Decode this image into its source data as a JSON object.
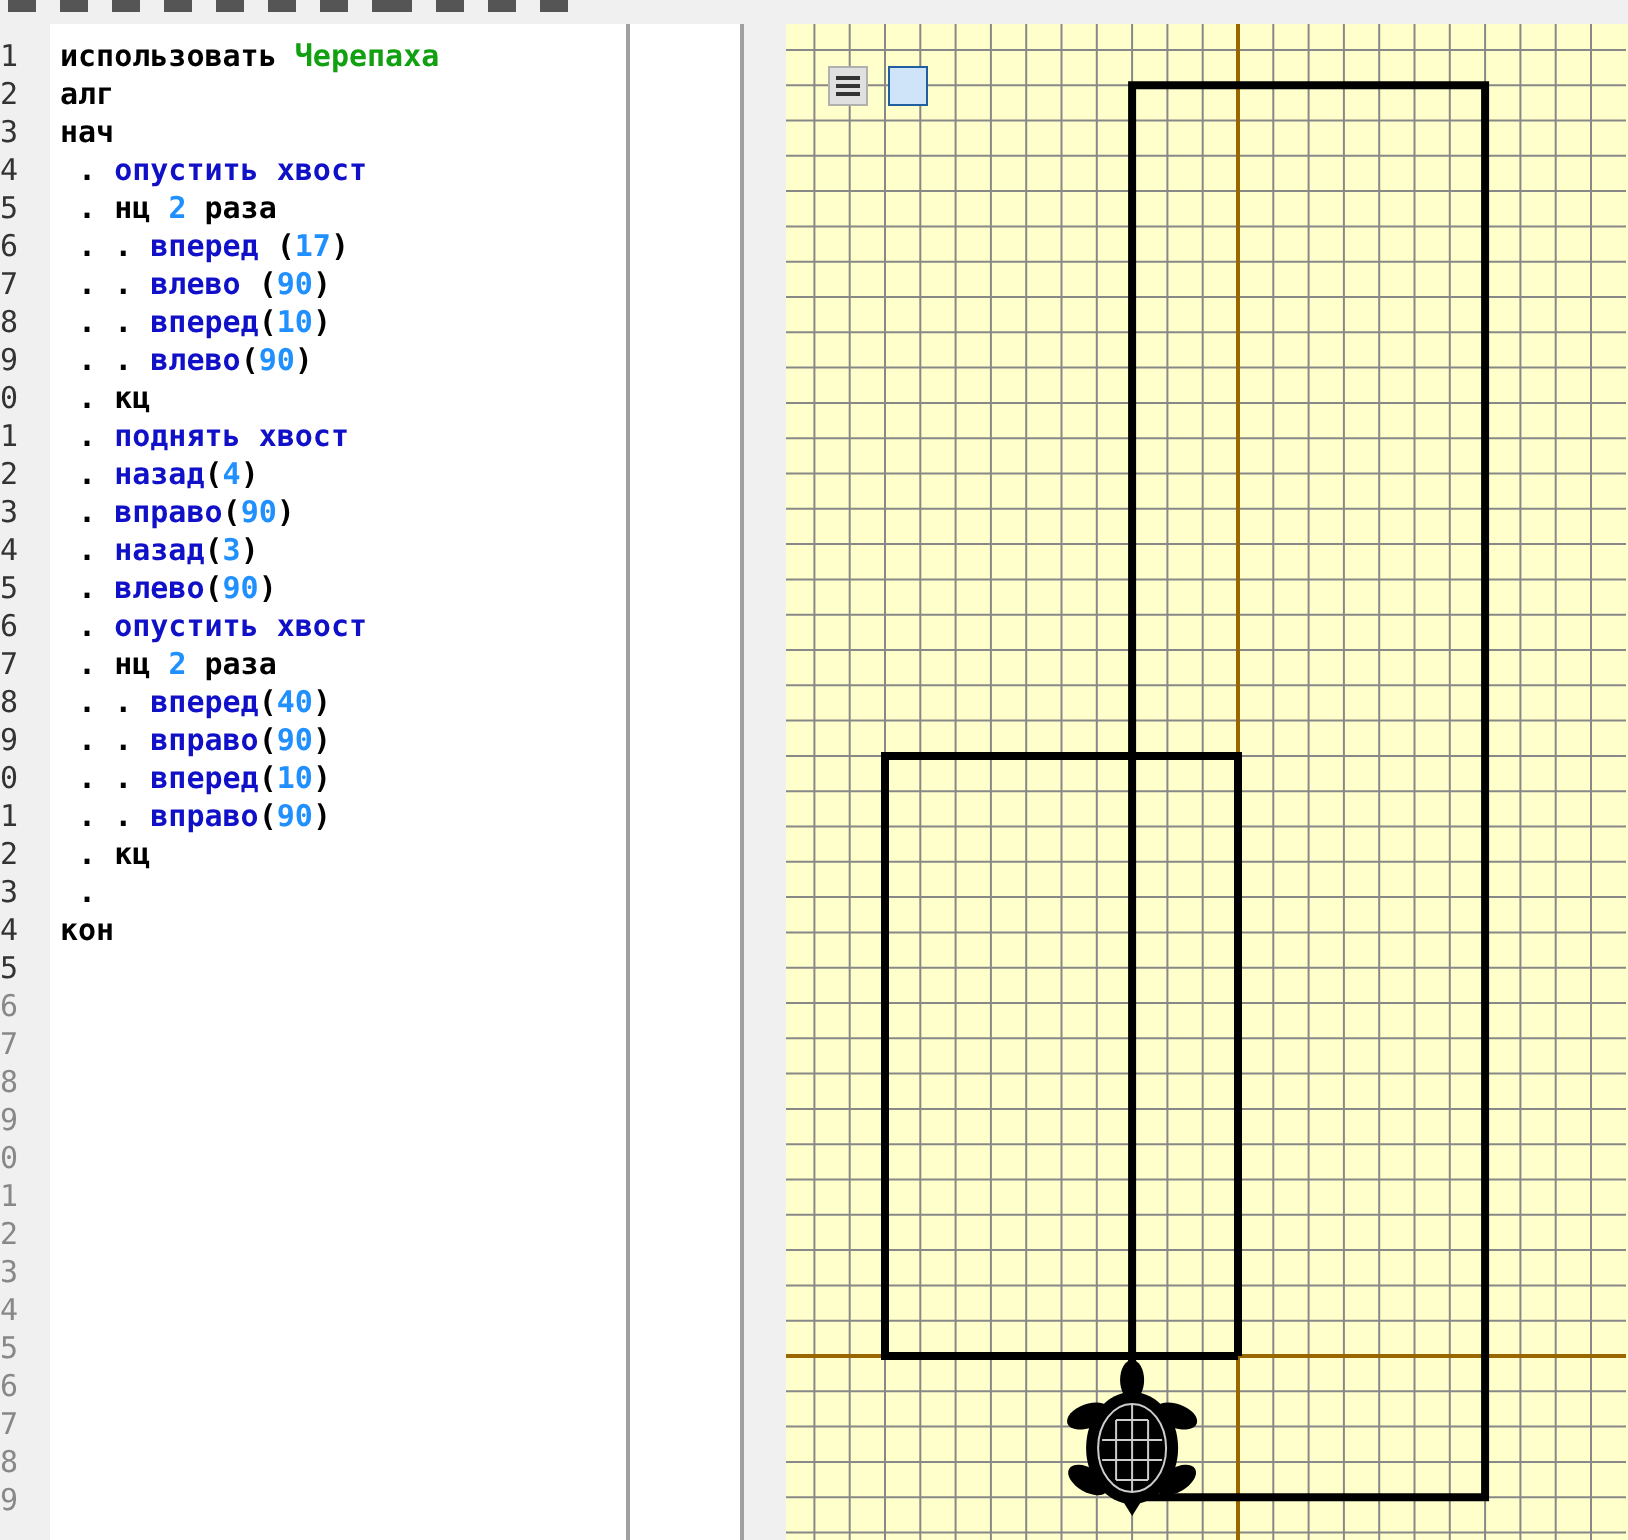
{
  "editor": {
    "lines": [
      {
        "number": "1",
        "tokens": [
          {
            "kind": "keyword",
            "text": "использовать "
          },
          {
            "kind": "module",
            "text": "Черепаха"
          }
        ]
      },
      {
        "number": "2",
        "tokens": [
          {
            "kind": "keyword",
            "text": "алг"
          }
        ]
      },
      {
        "number": "3",
        "tokens": [
          {
            "kind": "keyword",
            "text": "нач"
          }
        ]
      },
      {
        "number": "4",
        "tokens": [
          {
            "kind": "dot",
            "text": " . "
          },
          {
            "kind": "command",
            "text": "опустить хвост"
          }
        ]
      },
      {
        "number": "5",
        "tokens": [
          {
            "kind": "dot",
            "text": " . "
          },
          {
            "kind": "keyword",
            "text": "нц "
          },
          {
            "kind": "number",
            "text": "2"
          },
          {
            "kind": "keyword",
            "text": " раза"
          }
        ]
      },
      {
        "number": "6",
        "tokens": [
          {
            "kind": "dot",
            "text": " . . "
          },
          {
            "kind": "command",
            "text": "вперед "
          },
          {
            "kind": "paren",
            "text": "("
          },
          {
            "kind": "number",
            "text": "17"
          },
          {
            "kind": "paren",
            "text": ")"
          }
        ]
      },
      {
        "number": "7",
        "tokens": [
          {
            "kind": "dot",
            "text": " . . "
          },
          {
            "kind": "command",
            "text": "влево "
          },
          {
            "kind": "paren",
            "text": "("
          },
          {
            "kind": "number",
            "text": "90"
          },
          {
            "kind": "paren",
            "text": ")"
          }
        ]
      },
      {
        "number": "8",
        "tokens": [
          {
            "kind": "dot",
            "text": " . . "
          },
          {
            "kind": "command",
            "text": "вперед"
          },
          {
            "kind": "paren",
            "text": "("
          },
          {
            "kind": "number",
            "text": "10"
          },
          {
            "kind": "paren",
            "text": ")"
          }
        ]
      },
      {
        "number": "9",
        "tokens": [
          {
            "kind": "dot",
            "text": " . . "
          },
          {
            "kind": "command",
            "text": "влево"
          },
          {
            "kind": "paren",
            "text": "("
          },
          {
            "kind": "number",
            "text": "90"
          },
          {
            "kind": "paren",
            "text": ")"
          }
        ]
      },
      {
        "number": "0",
        "tokens": [
          {
            "kind": "dot",
            "text": " . "
          },
          {
            "kind": "keyword",
            "text": "кц"
          }
        ]
      },
      {
        "number": "1",
        "tokens": [
          {
            "kind": "dot",
            "text": " . "
          },
          {
            "kind": "command",
            "text": "поднять хвост"
          }
        ]
      },
      {
        "number": "2",
        "tokens": [
          {
            "kind": "dot",
            "text": " . "
          },
          {
            "kind": "command",
            "text": "назад"
          },
          {
            "kind": "paren",
            "text": "("
          },
          {
            "kind": "number",
            "text": "4"
          },
          {
            "kind": "paren",
            "text": ")"
          }
        ]
      },
      {
        "number": "3",
        "tokens": [
          {
            "kind": "dot",
            "text": " . "
          },
          {
            "kind": "command",
            "text": "вправо"
          },
          {
            "kind": "paren",
            "text": "("
          },
          {
            "kind": "number",
            "text": "90"
          },
          {
            "kind": "paren",
            "text": ")"
          }
        ]
      },
      {
        "number": "4",
        "tokens": [
          {
            "kind": "dot",
            "text": " . "
          },
          {
            "kind": "command",
            "text": "назад"
          },
          {
            "kind": "paren",
            "text": "("
          },
          {
            "kind": "number",
            "text": "3"
          },
          {
            "kind": "paren",
            "text": ")"
          }
        ]
      },
      {
        "number": "5",
        "tokens": [
          {
            "kind": "dot",
            "text": " . "
          },
          {
            "kind": "command",
            "text": "влево"
          },
          {
            "kind": "paren",
            "text": "("
          },
          {
            "kind": "number",
            "text": "90"
          },
          {
            "kind": "paren",
            "text": ")"
          }
        ]
      },
      {
        "number": "6",
        "tokens": [
          {
            "kind": "dot",
            "text": " . "
          },
          {
            "kind": "command",
            "text": "опустить хвост"
          }
        ]
      },
      {
        "number": "7",
        "tokens": [
          {
            "kind": "dot",
            "text": " . "
          },
          {
            "kind": "keyword",
            "text": "нц "
          },
          {
            "kind": "number",
            "text": "2"
          },
          {
            "kind": "keyword",
            "text": " раза"
          }
        ]
      },
      {
        "number": "8",
        "tokens": [
          {
            "kind": "dot",
            "text": " . . "
          },
          {
            "kind": "command",
            "text": "вперед"
          },
          {
            "kind": "paren",
            "text": "("
          },
          {
            "kind": "number",
            "text": "40"
          },
          {
            "kind": "paren",
            "text": ")"
          }
        ]
      },
      {
        "number": "9",
        "tokens": [
          {
            "kind": "dot",
            "text": " . . "
          },
          {
            "kind": "command",
            "text": "вправо"
          },
          {
            "kind": "paren",
            "text": "("
          },
          {
            "kind": "number",
            "text": "90"
          },
          {
            "kind": "paren",
            "text": ")"
          }
        ]
      },
      {
        "number": "0",
        "tokens": [
          {
            "kind": "dot",
            "text": " . . "
          },
          {
            "kind": "command",
            "text": "вперед"
          },
          {
            "kind": "paren",
            "text": "("
          },
          {
            "kind": "number",
            "text": "10"
          },
          {
            "kind": "paren",
            "text": ")"
          }
        ]
      },
      {
        "number": "1",
        "tokens": [
          {
            "kind": "dot",
            "text": " . . "
          },
          {
            "kind": "command",
            "text": "вправо"
          },
          {
            "kind": "paren",
            "text": "("
          },
          {
            "kind": "number",
            "text": "90"
          },
          {
            "kind": "paren",
            "text": ")"
          }
        ]
      },
      {
        "number": "2",
        "tokens": [
          {
            "kind": "dot",
            "text": " . "
          },
          {
            "kind": "keyword",
            "text": "кц"
          }
        ]
      },
      {
        "number": "3",
        "tokens": [
          {
            "kind": "dot",
            "text": " ."
          }
        ]
      },
      {
        "number": "4",
        "tokens": [
          {
            "kind": "keyword",
            "text": "кон"
          }
        ]
      },
      {
        "number": "5"
      },
      {
        "number": "6"
      },
      {
        "number": "7"
      },
      {
        "number": "8"
      },
      {
        "number": "9"
      },
      {
        "number": "0"
      },
      {
        "number": "1"
      },
      {
        "number": "2"
      },
      {
        "number": "3"
      },
      {
        "number": "4"
      },
      {
        "number": "5"
      },
      {
        "number": "6"
      },
      {
        "number": "7"
      },
      {
        "number": "8"
      },
      {
        "number": "9"
      }
    ]
  }
}
